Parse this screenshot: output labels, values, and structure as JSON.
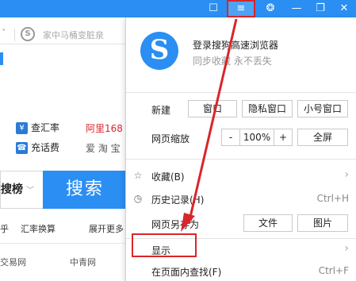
{
  "titlebar": {
    "buttons": [
      {
        "name": "sidebar-toggle-icon",
        "glyph": "☐"
      },
      {
        "name": "menu-icon",
        "glyph": "≡"
      },
      {
        "name": "skin-icon",
        "glyph": "❂"
      },
      {
        "name": "minimize-icon",
        "glyph": "—"
      },
      {
        "name": "restore-icon",
        "glyph": "❐"
      },
      {
        "name": "close-icon",
        "glyph": "✕"
      }
    ],
    "accent": "#2b8ef3",
    "highlight_color": "#d8262a"
  },
  "page": {
    "address_placeholder": "家中马桶变脏泉",
    "drop_glyph": "ˇ",
    "logo_letter": "S",
    "services": [
      {
        "icon": "¥",
        "label": "查汇率"
      },
      {
        "icon": "☎",
        "label": "充话费"
      }
    ],
    "services_right": [
      {
        "label": "阿里168",
        "red": true
      },
      {
        "label": "爱 淘 宝",
        "red": false
      }
    ],
    "search_type": "搜榜",
    "search_button": "搜索",
    "links": [
      "乎",
      "汇率换算",
      "展开更多"
    ],
    "links_row2": [
      "交易网",
      "中青网"
    ]
  },
  "panel": {
    "logo_letter": "S",
    "login_text": "登录搜狗高速浏览器",
    "sync_text": "同步收藏 永不丢失",
    "new_label": "新建",
    "new_buttons": [
      "窗口",
      "隐私窗口",
      "小号窗口"
    ],
    "zoom_label": "网页缩放",
    "zoom_minus": "-",
    "zoom_value": "100%",
    "zoom_plus": "+",
    "fullscreen": "全屏",
    "favorites": "收藏(B)",
    "history": "历史记录(H)",
    "history_shortcut": "Ctrl+H",
    "save_as": "网页另存为",
    "save_file": "文件",
    "save_image": "图片",
    "display": "显示",
    "find": "在页面内查找(F)",
    "find_shortcut": "Ctrl+F",
    "arrow_glyph": "›"
  }
}
